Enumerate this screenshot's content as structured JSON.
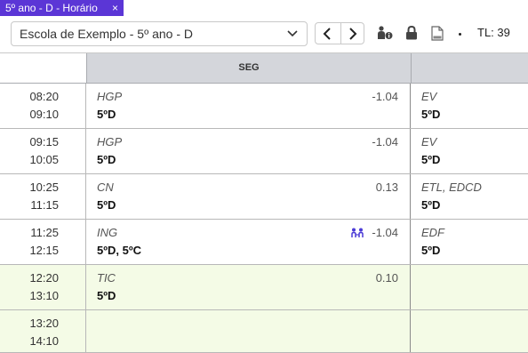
{
  "tab": {
    "title": "5º ano - D - Horário",
    "close_glyph": "×"
  },
  "toolbar": {
    "select_value": "Escola de Exemplo - 5º ano - D",
    "tl_label": "TL: 39"
  },
  "grid": {
    "day_header": "SEG",
    "rows": [
      {
        "start": "08:20",
        "end": "09:10",
        "seg_subject": "HGP",
        "seg_class": "5ºD",
        "seg_score": "-1.04",
        "next_subject": "EV",
        "next_class": "5ºD",
        "highlight": false
      },
      {
        "start": "09:15",
        "end": "10:05",
        "seg_subject": "HGP",
        "seg_class": "5ºD",
        "seg_score": "-1.04",
        "next_subject": "EV",
        "next_class": "5ºD",
        "highlight": false
      },
      {
        "start": "10:25",
        "end": "11:15",
        "seg_subject": "CN",
        "seg_class": "5ºD",
        "seg_score": "0.13",
        "next_subject": "ETL, EDCD",
        "next_class": "5ºD",
        "highlight": false
      },
      {
        "start": "11:25",
        "end": "12:15",
        "seg_subject": "ING",
        "seg_class": "5ºD, 5ºC",
        "seg_score": "-1.04",
        "next_subject": "EDF",
        "next_class": "5ºD",
        "highlight": false,
        "swap_icon": true
      },
      {
        "start": "12:20",
        "end": "13:10",
        "seg_subject": "TIC",
        "seg_class": "5ºD",
        "seg_score": "0.10",
        "next_subject": "",
        "next_class": "",
        "highlight": true
      },
      {
        "start": "13:20",
        "end": "14:10",
        "seg_subject": "",
        "seg_class": "",
        "seg_score": "",
        "next_subject": "",
        "next_class": "",
        "highlight": true
      }
    ]
  },
  "colors": {
    "tab_bg": "#5b36d6",
    "header_bg": "#d4d6db",
    "green_row": "#f4fbe6",
    "swap_icon": "#4b3bd6"
  },
  "icons": [
    "close-icon",
    "chevron-down-icon",
    "chevron-left-icon",
    "chevron-right-icon",
    "person-info-icon",
    "lock-icon",
    "pdf-icon",
    "shuffle-icon"
  ]
}
